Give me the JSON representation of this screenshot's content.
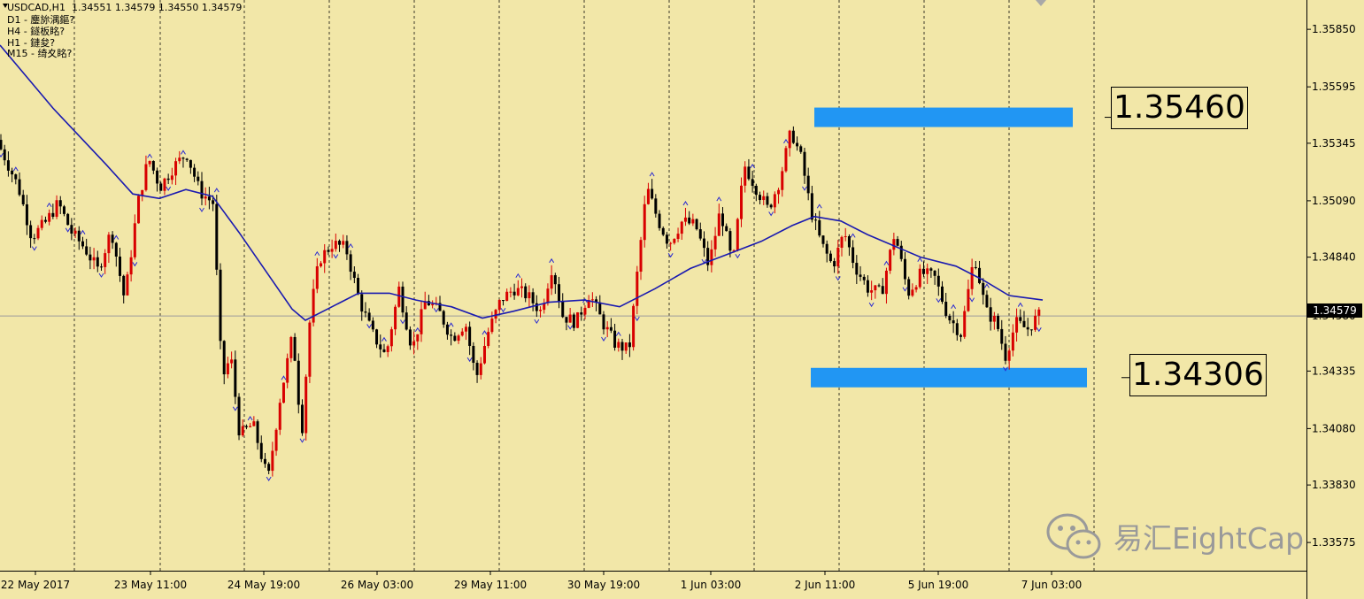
{
  "header": {
    "title": "USDCAD,H1  1.34551 1.34579 1.34550 1.34579",
    "timeframes": [
      "D1 - 鏖旀湡鏂?",
      "H4 - 鐩板眳?",
      "H1 - 鏈夋?",
      "M15 - 绮夊眳?"
    ]
  },
  "current_price": "1.34579",
  "levels": [
    {
      "label": "1.35460",
      "value": 1.3546
    },
    {
      "label": "1.34306",
      "value": 1.34306
    }
  ],
  "watermark": "易汇EightCap",
  "colors": {
    "background": "#f2e7a8",
    "bull": "#d80000",
    "bear": "#000000",
    "ma": "#1a1ab0",
    "zone": "#2196f3",
    "fractal": "#2a2ad0"
  },
  "chart_data": {
    "type": "candlestick",
    "symbol": "USDCAD",
    "timeframe": "H1",
    "ylim": [
      1.3345,
      1.3598
    ],
    "yticks": [
      "1.35850",
      "1.35595",
      "1.35345",
      "1.35090",
      "1.34840",
      "1.34580",
      "1.34335",
      "1.34080",
      "1.33830",
      "1.33575"
    ],
    "xticks": [
      "22 May 2017",
      "23 May 11:00",
      "24 May 19:00",
      "26 May 03:00",
      "29 May 11:00",
      "30 May 19:00",
      "1 Jun 03:00",
      "2 Jun 11:00",
      "5 Jun 19:00",
      "7 Jun 03:00"
    ],
    "grid": true,
    "price_path": [
      [
        0,
        1.3536
      ],
      [
        10,
        1.3528
      ],
      [
        25,
        1.3515
      ],
      [
        40,
        1.3493
      ],
      [
        55,
        1.3499
      ],
      [
        70,
        1.3508
      ],
      [
        85,
        1.3495
      ],
      [
        100,
        1.3488
      ],
      [
        115,
        1.3478
      ],
      [
        130,
        1.3496
      ],
      [
        145,
        1.3465
      ],
      [
        160,
        1.3508
      ],
      [
        172,
        1.3528
      ],
      [
        185,
        1.3515
      ],
      [
        200,
        1.3524
      ],
      [
        215,
        1.353
      ],
      [
        230,
        1.3513
      ],
      [
        245,
        1.3508
      ],
      [
        255,
        1.343
      ],
      [
        265,
        1.344
      ],
      [
        275,
        1.3405
      ],
      [
        290,
        1.341
      ],
      [
        307,
        1.3385
      ],
      [
        320,
        1.342
      ],
      [
        335,
        1.345
      ],
      [
        345,
        1.3405
      ],
      [
        355,
        1.346
      ],
      [
        365,
        1.3483
      ],
      [
        380,
        1.349
      ],
      [
        395,
        1.3488
      ],
      [
        410,
        1.3465
      ],
      [
        425,
        1.345
      ],
      [
        440,
        1.344
      ],
      [
        455,
        1.347
      ],
      [
        470,
        1.3443
      ],
      [
        485,
        1.3465
      ],
      [
        500,
        1.346
      ],
      [
        515,
        1.3448
      ],
      [
        530,
        1.3455
      ],
      [
        542,
        1.343
      ],
      [
        555,
        1.345
      ],
      [
        570,
        1.3465
      ],
      [
        585,
        1.347
      ],
      [
        600,
        1.3467
      ],
      [
        615,
        1.346
      ],
      [
        628,
        1.348
      ],
      [
        640,
        1.3458
      ],
      [
        655,
        1.3455
      ],
      [
        670,
        1.3468
      ],
      [
        685,
        1.3455
      ],
      [
        700,
        1.3445
      ],
      [
        715,
        1.3443
      ],
      [
        725,
        1.348
      ],
      [
        735,
        1.3515
      ],
      [
        748,
        1.35
      ],
      [
        760,
        1.349
      ],
      [
        775,
        1.35
      ],
      [
        790,
        1.3498
      ],
      [
        805,
        1.348
      ],
      [
        818,
        1.3505
      ],
      [
        832,
        1.348
      ],
      [
        845,
        1.3525
      ],
      [
        858,
        1.3515
      ],
      [
        872,
        1.3505
      ],
      [
        885,
        1.3518
      ],
      [
        898,
        1.354
      ],
      [
        910,
        1.3527
      ],
      [
        920,
        1.3505
      ],
      [
        932,
        1.349
      ],
      [
        945,
        1.348
      ],
      [
        958,
        1.3495
      ],
      [
        970,
        1.348
      ],
      [
        985,
        1.347
      ],
      [
        1000,
        1.3468
      ],
      [
        1015,
        1.3495
      ],
      [
        1030,
        1.3468
      ],
      [
        1045,
        1.3477
      ],
      [
        1060,
        1.3475
      ],
      [
        1075,
        1.3458
      ],
      [
        1090,
        1.345
      ],
      [
        1105,
        1.3485
      ],
      [
        1118,
        1.346
      ],
      [
        1130,
        1.3455
      ],
      [
        1140,
        1.344
      ],
      [
        1152,
        1.3455
      ],
      [
        1165,
        1.3452
      ],
      [
        1177,
        1.3458
      ]
    ],
    "moving_average": [
      [
        0,
        1.3578
      ],
      [
        60,
        1.355
      ],
      [
        120,
        1.3525
      ],
      [
        150,
        1.3512
      ],
      [
        180,
        1.351
      ],
      [
        210,
        1.3514
      ],
      [
        240,
        1.3511
      ],
      [
        270,
        1.3495
      ],
      [
        300,
        1.3478
      ],
      [
        330,
        1.3461
      ],
      [
        345,
        1.3456
      ],
      [
        370,
        1.3461
      ],
      [
        405,
        1.3468
      ],
      [
        440,
        1.3468
      ],
      [
        470,
        1.3465
      ],
      [
        510,
        1.3462
      ],
      [
        545,
        1.3457
      ],
      [
        580,
        1.346
      ],
      [
        620,
        1.3464
      ],
      [
        660,
        1.3465
      ],
      [
        700,
        1.3462
      ],
      [
        740,
        1.347
      ],
      [
        780,
        1.3479
      ],
      [
        820,
        1.3485
      ],
      [
        860,
        1.3491
      ],
      [
        895,
        1.3498
      ],
      [
        920,
        1.3502
      ],
      [
        950,
        1.35
      ],
      [
        980,
        1.3494
      ],
      [
        1010,
        1.3489
      ],
      [
        1040,
        1.3484
      ],
      [
        1080,
        1.348
      ],
      [
        1110,
        1.3474
      ],
      [
        1140,
        1.3467
      ],
      [
        1178,
        1.3465
      ]
    ],
    "bars": 280
  }
}
